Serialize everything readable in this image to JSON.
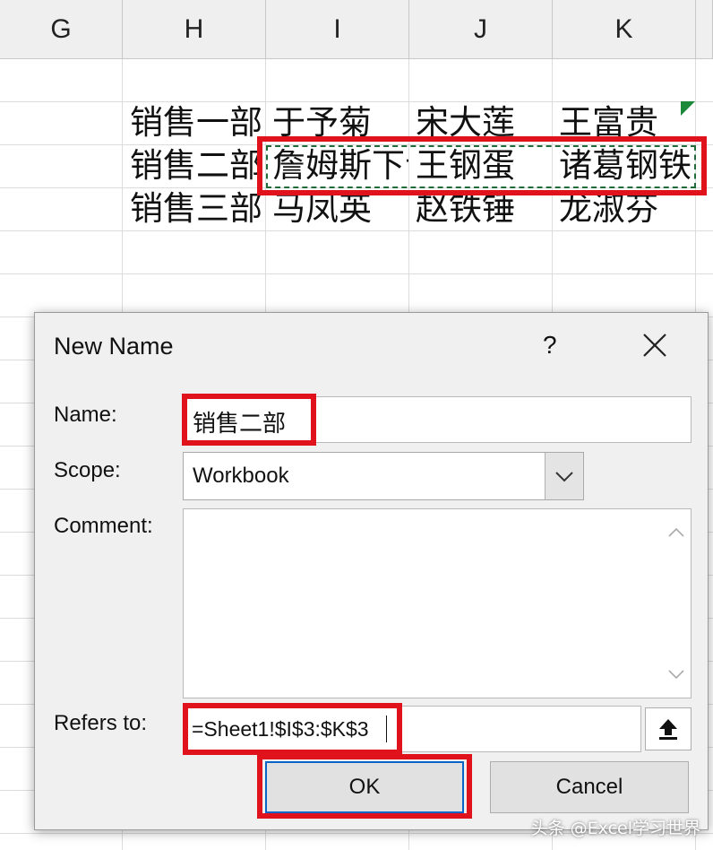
{
  "spreadsheet": {
    "columns": [
      "G",
      "H",
      "I",
      "J",
      "K"
    ],
    "rows": [
      [
        "销售一部",
        "于予菊",
        "宋大莲",
        "王富贵"
      ],
      [
        "销售二部",
        "詹姆斯下士",
        "王钢蛋",
        "诸葛钢铁"
      ],
      [
        "销售三部",
        "马凤英",
        "赵铁锤",
        "龙淑芬"
      ]
    ]
  },
  "dialog": {
    "title": "New Name",
    "help_label": "?",
    "name_label": "Name:",
    "name_value": "销售二部",
    "scope_label": "Scope:",
    "scope_value": "Workbook",
    "comment_label": "Comment:",
    "comment_value": "",
    "refers_label": "Refers to:",
    "refers_value": "=Sheet1!$I$3:$K$3",
    "ok_label": "OK",
    "cancel_label": "Cancel"
  },
  "watermark": "头条 @Excel学习世界",
  "colors": {
    "highlight_red": "#e0121b",
    "marquee_green": "#1f6b3a",
    "ok_border_blue": "#0a64c8"
  }
}
